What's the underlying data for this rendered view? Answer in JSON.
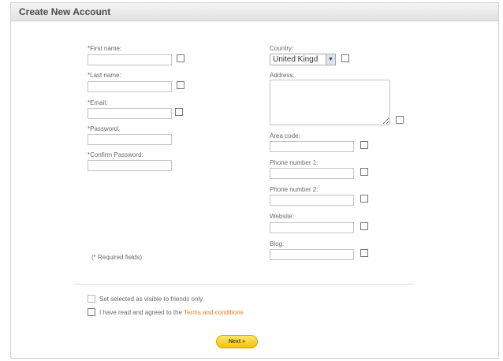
{
  "header": {
    "title": "Create New Account"
  },
  "left": {
    "first_name": {
      "label": "First name:",
      "required": "*",
      "value": ""
    },
    "last_name": {
      "label": "Last name:",
      "required": "*",
      "value": ""
    },
    "email": {
      "label": "Email:",
      "required": "*",
      "value": ""
    },
    "password": {
      "label": "Password:",
      "required": "*",
      "value": ""
    },
    "confirm_password": {
      "label": "Confirm Password:",
      "required": "*",
      "value": ""
    },
    "required_note": "(* Required fields)"
  },
  "right": {
    "country": {
      "label": "Country:",
      "value": "United Kingd"
    },
    "address": {
      "label": "Address:",
      "value": ""
    },
    "area_code": {
      "label": "Area code:",
      "value": ""
    },
    "phone1": {
      "label": "Phone number 1:",
      "value": ""
    },
    "phone2": {
      "label": "Phone number 2:",
      "value": ""
    },
    "website": {
      "label": "Website:",
      "value": ""
    },
    "blog": {
      "label": "Blog:",
      "value": ""
    }
  },
  "options": {
    "visible_to_friends": "Set selected as visible to friends only",
    "agree_prefix": "I have read and agreed to the ",
    "terms_link": "Terms and conditions"
  },
  "next_button": "Next »",
  "colors": {
    "required_mark": "#dd3333",
    "link": "#f07a1a",
    "button": "#f3c10c"
  },
  "icons": {
    "select_arrow": "chevron-down-icon"
  }
}
